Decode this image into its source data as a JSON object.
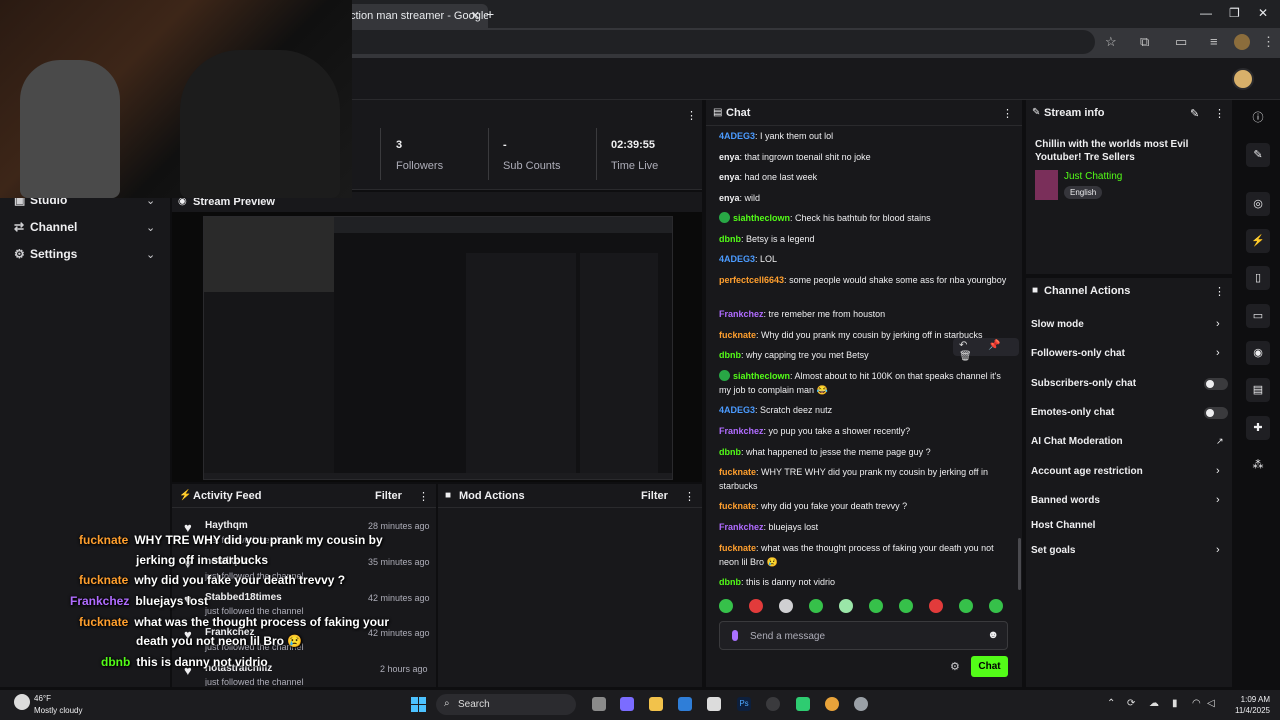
{
  "browser": {
    "tab_title": "ction man streamer - Google",
    "tab_close": "✕",
    "new_tab": "+",
    "window_controls": [
      "—",
      "❐",
      "✕"
    ]
  },
  "nav": {
    "items": [
      {
        "label": "Studio",
        "icon": "studio-icon"
      },
      {
        "label": "Channel",
        "icon": "channel-icon"
      },
      {
        "label": "Settings",
        "icon": "gear-icon"
      }
    ]
  },
  "stats": [
    {
      "value": "3",
      "label": "Followers"
    },
    {
      "value": "-",
      "label": "Sub Counts"
    },
    {
      "value": "02:39:55",
      "label": "Time Live"
    }
  ],
  "preview": {
    "title": "Stream Preview"
  },
  "activity_feed": {
    "title": "Activity Feed",
    "filter_label": "Filter",
    "items": [
      {
        "name": "Haythqm",
        "sub": "just followed the channel",
        "time": "28 minutes ago"
      },
      {
        "name": "notalkplz",
        "sub": "just followed the channel",
        "time": "35 minutes ago"
      },
      {
        "name": "Stabbed18times",
        "sub": "just followed the channel",
        "time": "42 minutes ago"
      },
      {
        "name": "Frankchez",
        "sub": "just followed the channel",
        "time": "42 minutes ago"
      },
      {
        "name": "notastraichillz",
        "sub": "just followed the channel",
        "time": "2 hours ago"
      }
    ]
  },
  "mod_actions": {
    "title": "Mod Actions",
    "filter_label": "Filter"
  },
  "overlay_chat": [
    {
      "user": "fucknate",
      "color": "#ff9f2e",
      "text": "WHY TRE WHY did you prank my cousin by",
      "cont": "jerking off in starbucks"
    },
    {
      "user": "fucknate",
      "color": "#ff9f2e",
      "text": "why did you fake your death trevvy ?",
      "cont": ""
    },
    {
      "user": "Frankchez",
      "color": "#b06cff",
      "text": "bluejays lost",
      "cont": ""
    },
    {
      "user": "fucknate",
      "color": "#ff9f2e",
      "text": "what was the thought process of faking your",
      "cont": "death you not neon lil Bro 😢"
    },
    {
      "user": "dbnb",
      "color": "#53fc18",
      "text": "this is danny not vidrio",
      "cont": ""
    }
  ],
  "chat": {
    "title": "Chat",
    "messages": [
      {
        "user": "4ADEG3",
        "color": "#4b9bff",
        "badge": false,
        "text": "I yank them out lol"
      },
      {
        "user": "enya",
        "color": "#efeff1",
        "badge": false,
        "text": "that ingrown toenail shit no joke"
      },
      {
        "user": "enya",
        "color": "#efeff1",
        "badge": false,
        "text": "had one last week"
      },
      {
        "user": "enya",
        "color": "#efeff1",
        "badge": false,
        "text": "wild"
      },
      {
        "user": "siahtheclown",
        "color": "#53fc18",
        "badge": true,
        "text": "Check his bathtub for blood stains"
      },
      {
        "user": "dbnb",
        "color": "#53fc18",
        "badge": false,
        "text": "Betsy is a legend"
      },
      {
        "user": "4ADEG3",
        "color": "#4b9bff",
        "badge": false,
        "text": "LOL"
      },
      {
        "user": "perfectcell6643",
        "color": "#ff9f2e",
        "badge": false,
        "text": "some people would shake some ass for nba youngboy"
      },
      {
        "user": "Frankchez",
        "color": "#b06cff",
        "badge": false,
        "text": "tre remeber me from houston"
      },
      {
        "user": "fucknate",
        "color": "#ff9f2e",
        "badge": false,
        "text": "Why did you prank my cousin by jerking off in starbucks"
      },
      {
        "user": "dbnb",
        "color": "#53fc18",
        "badge": false,
        "text": "why capping tre you met Betsy"
      },
      {
        "user": "siahtheclown",
        "color": "#53fc18",
        "badge": true,
        "text": "Almost about to hit 100K on that speaks channel it's my job to complain man 😂"
      },
      {
        "user": "4ADEG3",
        "color": "#4b9bff",
        "badge": false,
        "text": "Scratch deez nutz"
      },
      {
        "user": "Frankchez",
        "color": "#b06cff",
        "badge": false,
        "text": "yo pup you take a shower recently?"
      },
      {
        "user": "dbnb",
        "color": "#53fc18",
        "badge": false,
        "text": "what happened to jesse the meme page guy ?"
      },
      {
        "user": "fucknate",
        "color": "#ff9f2e",
        "badge": false,
        "text": "WHY TRE WHY did you prank my cousin by jerking off in starbucks"
      },
      {
        "user": "fucknate",
        "color": "#ff9f2e",
        "badge": false,
        "text": "why did you fake your death trevvy ?"
      },
      {
        "user": "Frankchez",
        "color": "#b06cff",
        "badge": false,
        "text": "bluejays lost"
      },
      {
        "user": "fucknate",
        "color": "#ff9f2e",
        "badge": false,
        "text": "what was the thought process of faking your death you not neon lil Bro 😢"
      },
      {
        "user": "dbnb",
        "color": "#53fc18",
        "badge": false,
        "text": "this is danny not vidrio"
      }
    ],
    "message_actions": "↶ 📌 🗑",
    "input_placeholder": "Send a message",
    "send_label": "Chat"
  },
  "stream_info": {
    "title": "Stream info",
    "stream_title": "Chillin with the worlds most Evil Youtuber! Tre Sellers",
    "category": "Just Chatting",
    "language": "English"
  },
  "channel_actions": {
    "title": "Channel Actions",
    "items": [
      {
        "label": "Slow mode",
        "control": "chevron"
      },
      {
        "label": "Followers-only chat",
        "control": "chevron"
      },
      {
        "label": "Subscribers-only chat",
        "control": "toggle"
      },
      {
        "label": "Emotes-only chat",
        "control": "toggle"
      },
      {
        "label": "AI Chat Moderation",
        "control": "external"
      },
      {
        "label": "Account age restriction",
        "control": "chevron"
      },
      {
        "label": "Banned words",
        "control": "chevron"
      },
      {
        "label": "Host Channel",
        "control": "none"
      },
      {
        "label": "Set goals",
        "control": "chevron"
      }
    ]
  },
  "taskbar": {
    "weather_temp": "46°F",
    "weather_desc": "Mostly cloudy",
    "search_label": "Search",
    "time": "1:09 AM",
    "date": "11/4/2025"
  },
  "colors": {
    "accent": "#53fc18",
    "panel_bg": "#18181b",
    "page_bg": "#0e0e10"
  }
}
